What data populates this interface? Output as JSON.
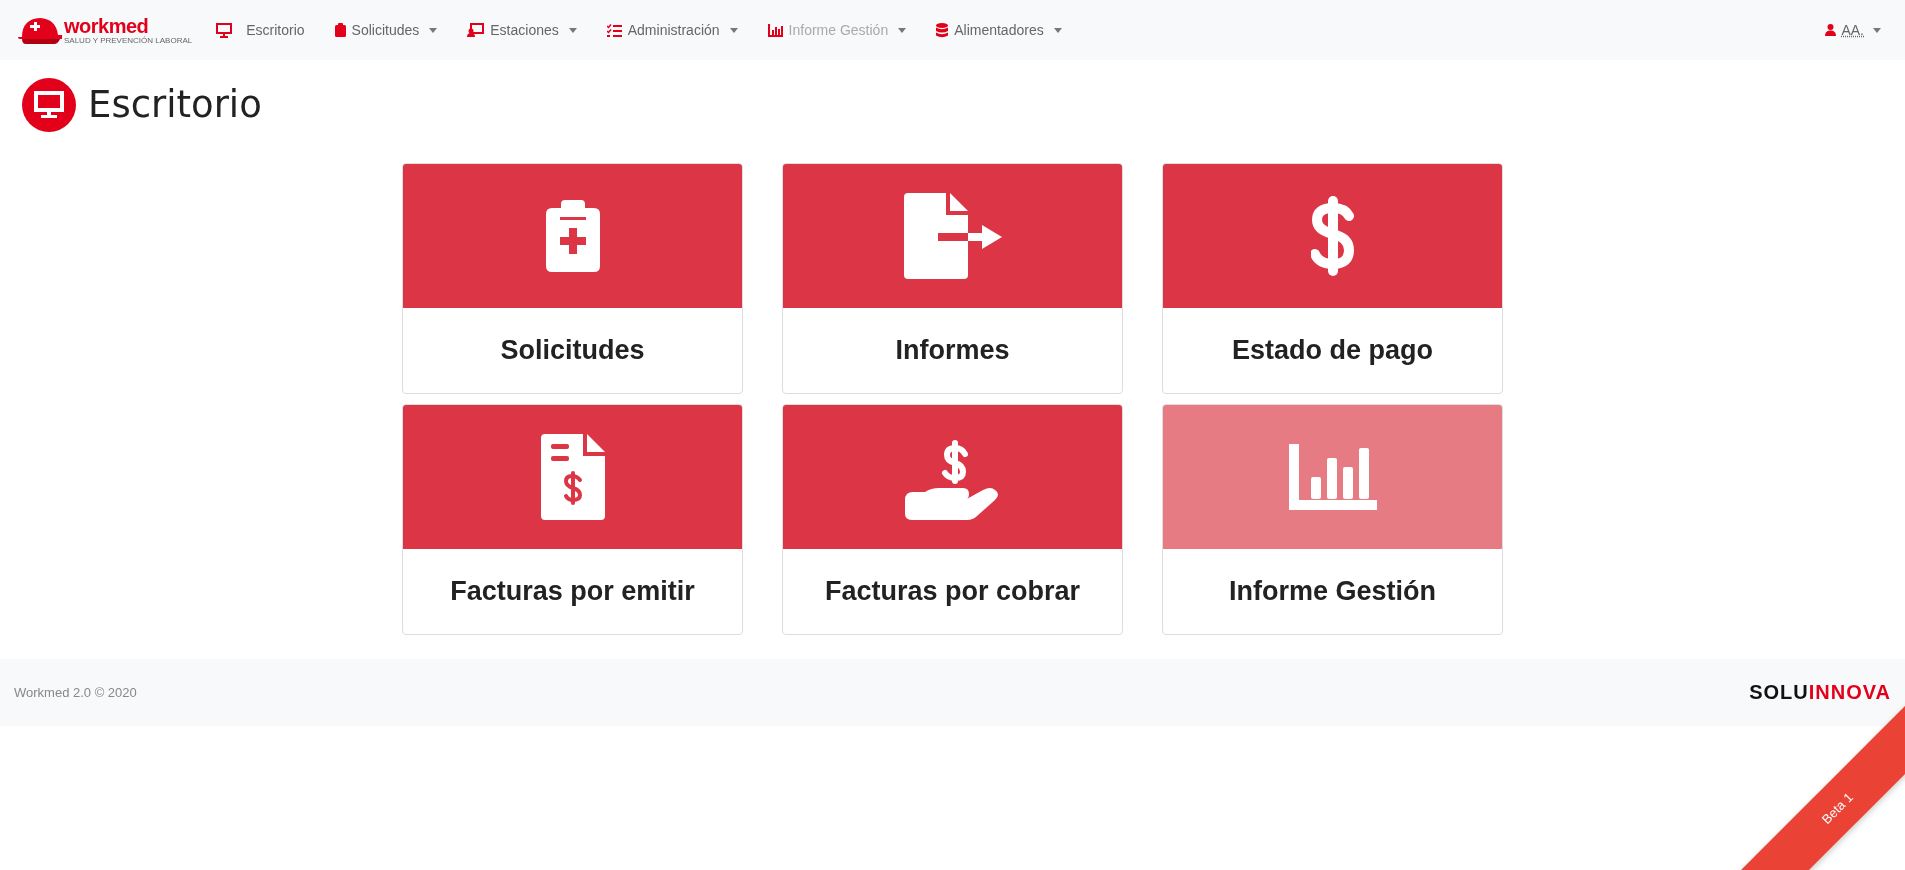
{
  "brand": {
    "name": "workmed",
    "tagline": "SALUD Y PREVENCIÓN LABORAL"
  },
  "nav": [
    {
      "label": "Escritorio",
      "dropdown": false,
      "disabled": false
    },
    {
      "label": "Solicitudes",
      "dropdown": true,
      "disabled": false
    },
    {
      "label": "Estaciones",
      "dropdown": true,
      "disabled": false
    },
    {
      "label": "Administración",
      "dropdown": true,
      "disabled": false
    },
    {
      "label": "Informe Gestión",
      "dropdown": true,
      "disabled": true
    },
    {
      "label": "Alimentadores",
      "dropdown": true,
      "disabled": false
    }
  ],
  "user": {
    "label": "AA."
  },
  "page_title": "Escritorio",
  "tiles": [
    {
      "label": "Solicitudes",
      "disabled": false
    },
    {
      "label": "Informes",
      "disabled": false
    },
    {
      "label": "Estado de pago",
      "disabled": false
    },
    {
      "label": "Facturas por emitir",
      "disabled": false
    },
    {
      "label": "Facturas por cobrar",
      "disabled": false
    },
    {
      "label": "Informe Gestión",
      "disabled": true
    }
  ],
  "footer": {
    "text": "Workmed 2.0 © 2020",
    "brand_a": "SOLU",
    "brand_b": "INNOVA"
  },
  "ribbon": "Beta 1"
}
